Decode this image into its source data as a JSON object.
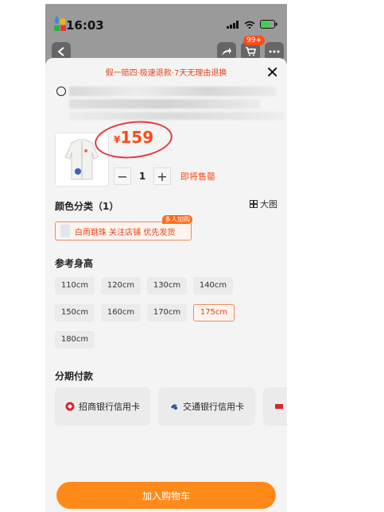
{
  "status_bar": {
    "time": "16:03"
  },
  "header": {
    "cart_badge": "99+"
  },
  "sheet": {
    "promo_text": "假一赔四·极速退款·7天无理由退换",
    "close_symbol": "✕"
  },
  "product": {
    "currency": "¥",
    "price": "159",
    "quantity": "1",
    "minus": "−",
    "plus": "+",
    "presale_label": "即将售罄"
  },
  "color_section": {
    "title": "颜色分类（1）",
    "big_image_label": "大图",
    "option_label": "白雨跳珠 关注店铺 优先发货",
    "option_tag": "多人加购"
  },
  "height_section": {
    "title": "参考身高",
    "sizes": [
      "110cm",
      "120cm",
      "130cm",
      "140cm",
      "150cm",
      "160cm",
      "170cm",
      "175cm",
      "180cm"
    ],
    "selected": "175cm"
  },
  "installment_section": {
    "title": "分期付款",
    "banks": [
      "招商银行信用卡",
      "交通银行信用卡"
    ]
  },
  "cta": {
    "add_to_cart": "加入购物车"
  },
  "colors": {
    "accent": "#ff4a18",
    "cta": "#ff8a1a"
  }
}
